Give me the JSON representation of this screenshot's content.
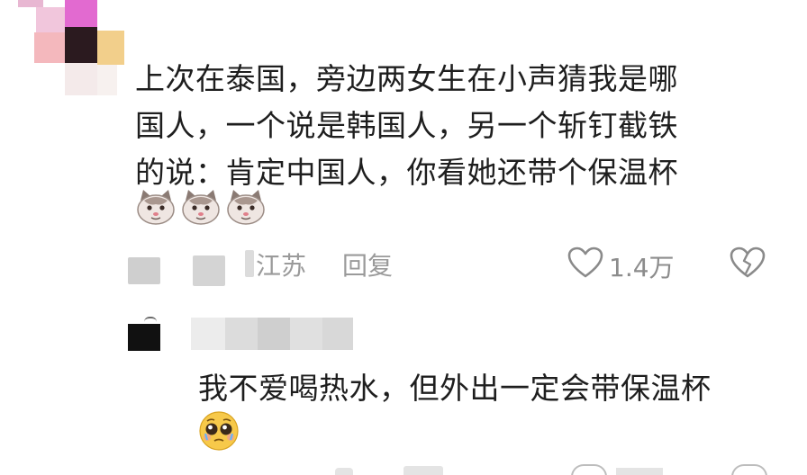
{
  "comment": {
    "lines": [
      "上次在泰国，旁边两女生在小声猜我是哪",
      "国人，一个说是韩国人，另一个斩钉截铁",
      "的说：肯定中国人，你看她还带个保温杯"
    ],
    "emoji_names": [
      "cat-face-emoji",
      "cat-face-emoji",
      "cat-face-emoji"
    ],
    "location_partial": "江苏",
    "reply_label": "回复",
    "like_count": "1.4万",
    "icons": {
      "like": "heart-outline-icon",
      "dislike": "broken-heart-icon"
    }
  },
  "reply": {
    "text": "我不爱喝热水，但外出一定会带保温杯",
    "emoji_name": "pleading-face-emoji"
  },
  "colors": {
    "text": "#1e1e1e",
    "meta": "#9a9a9a",
    "background": "#ffffff"
  }
}
